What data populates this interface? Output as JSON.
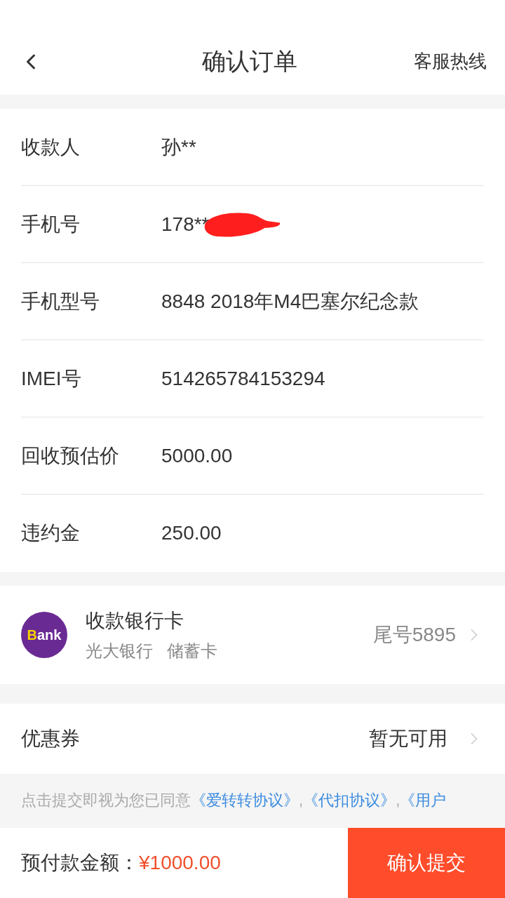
{
  "header": {
    "title": "确认订单",
    "action": "客服热线"
  },
  "fields": [
    {
      "label": "收款人",
      "value": "孙**",
      "redacted": false
    },
    {
      "label": "手机号",
      "value": "178**",
      "redacted": true
    },
    {
      "label": "手机型号",
      "value": "8848 2018年M4巴塞尔纪念款",
      "redacted": false
    },
    {
      "label": "IMEI号",
      "value": "514265784153294",
      "redacted": false
    },
    {
      "label": "回收预估价",
      "value": "5000.00",
      "redacted": false
    },
    {
      "label": "违约金",
      "value": "250.00",
      "redacted": false
    }
  ],
  "bank_card": {
    "logo": {
      "initial": "B",
      "rest": "ank"
    },
    "title": "收款银行卡",
    "bank": "光大银行",
    "card_type": "储蓄卡",
    "tail": "尾号5895"
  },
  "coupon": {
    "label": "优惠券",
    "value": "暂无可用"
  },
  "agreement": [
    {
      "kind": "text",
      "text": "点击提交即视为您已同意"
    },
    {
      "kind": "link",
      "text": "《爱转转协议》"
    },
    {
      "kind": "text",
      "text": ","
    },
    {
      "kind": "link",
      "text": "《代扣协议》"
    },
    {
      "kind": "text",
      "text": ","
    },
    {
      "kind": "link",
      "text": "《用户"
    }
  ],
  "footer": {
    "label": "预付款金额：",
    "amount": "¥1000.00",
    "submit": "确认提交"
  }
}
